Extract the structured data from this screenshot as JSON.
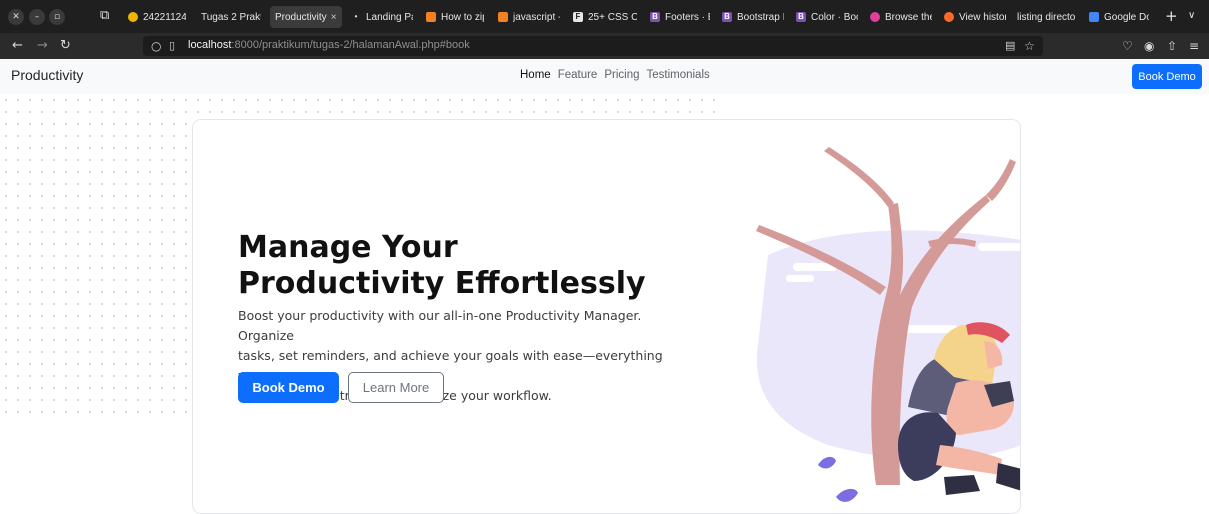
{
  "browser": {
    "tabs": [
      {
        "label": "242211241",
        "icon": "yellow-circle-icon"
      },
      {
        "label": "Tugas 2 Praktik",
        "icon": ""
      },
      {
        "label": "Productivity",
        "icon": "",
        "active": true
      },
      {
        "label": "Landing Pa",
        "icon": "dot-icon"
      },
      {
        "label": "How to zip",
        "icon": "stackoverflow-icon"
      },
      {
        "label": "javascript -",
        "icon": "stackoverflow-icon"
      },
      {
        "label": "25+ CSS Ca",
        "icon": "f-icon"
      },
      {
        "label": "Footers · Bo",
        "icon": "bootstrap-icon"
      },
      {
        "label": "Bootstrap I",
        "icon": "bootstrap-icon"
      },
      {
        "label": "Color · Boot",
        "icon": "bootstrap-icon"
      },
      {
        "label": "Browse the",
        "icon": "pink-circle-icon"
      },
      {
        "label": "View histor",
        "icon": "orange-circle-icon"
      },
      {
        "label": "listing director",
        "icon": ""
      },
      {
        "label": "Google Doc",
        "icon": "google-docs-icon"
      }
    ],
    "url": {
      "host": "localhost",
      "rest": ":8000/praktikum/tugas-2/halamanAwal.php#book"
    }
  },
  "site": {
    "brand": "Productivity",
    "nav": [
      {
        "label": "Home",
        "active": true
      },
      {
        "label": "Feature"
      },
      {
        "label": "Pricing"
      },
      {
        "label": "Testimonials"
      }
    ],
    "nav_button": "Book Demo"
  },
  "hero": {
    "title_line1": "Manage Your",
    "title_line2": "Productivity Effortlessly",
    "text_line1": "Boost your productivity with our all-in-one Productivity Manager. Organize",
    "text_line2": "tasks, set reminders, and achieve your goals with ease—everything you",
    "text_line3": "need to stay on track and optimize your workflow.",
    "primary_button": "Book Demo",
    "secondary_button": "Learn More"
  },
  "colors": {
    "primary": "#0d6efd",
    "navbar_bg": "#f8f9fa",
    "browser_dark": "#1f1f1f",
    "tree": "#d49a98",
    "lavender": "#ebe7fb"
  }
}
